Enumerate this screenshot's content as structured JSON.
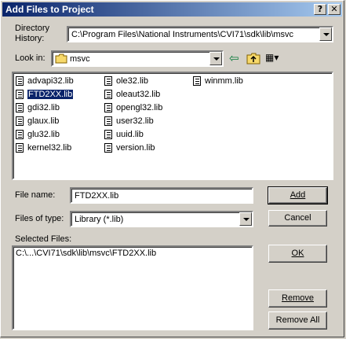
{
  "window": {
    "title": "Add Files to Project",
    "help_glyph": "?",
    "close_glyph": "✕"
  },
  "history": {
    "label_line1": "Directory",
    "label_line2": "History:",
    "value": "C:\\Program Files\\National Instruments\\CVI71\\sdk\\lib\\msvc"
  },
  "lookin": {
    "label": "Look in:",
    "value": "msvc"
  },
  "toolbar": {
    "back_glyph": "⇦",
    "up_glyph": "⮤",
    "view_glyph": "▦▾"
  },
  "files": [
    {
      "name": "advapi32.lib"
    },
    {
      "name": "FTD2XX.lib"
    },
    {
      "name": "gdi32.lib"
    },
    {
      "name": "glaux.lib"
    },
    {
      "name": "glu32.lib"
    },
    {
      "name": "kernel32.lib"
    },
    {
      "name": "ole32.lib"
    },
    {
      "name": "oleaut32.lib"
    },
    {
      "name": "opengl32.lib"
    },
    {
      "name": "user32.lib"
    },
    {
      "name": "uuid.lib"
    },
    {
      "name": "version.lib"
    },
    {
      "name": "winmm.lib"
    }
  ],
  "filename": {
    "label": "File name:",
    "value": "FTD2XX.lib"
  },
  "filetype": {
    "label": "Files of type:",
    "value": "Library (*.lib)"
  },
  "selected": {
    "label": "Selected Files:",
    "items": [
      "C:\\...\\CVI71\\sdk\\lib\\msvc\\FTD2XX.lib"
    ]
  },
  "buttons": {
    "add": "Add",
    "cancel": "Cancel",
    "ok": "OK",
    "remove": "Remove",
    "remove_all": "Remove All"
  },
  "colors": {
    "titlebar_start": "#0a246a",
    "titlebar_end": "#a6caf0",
    "selection": "#0a246a",
    "face": "#d4d0c8"
  }
}
